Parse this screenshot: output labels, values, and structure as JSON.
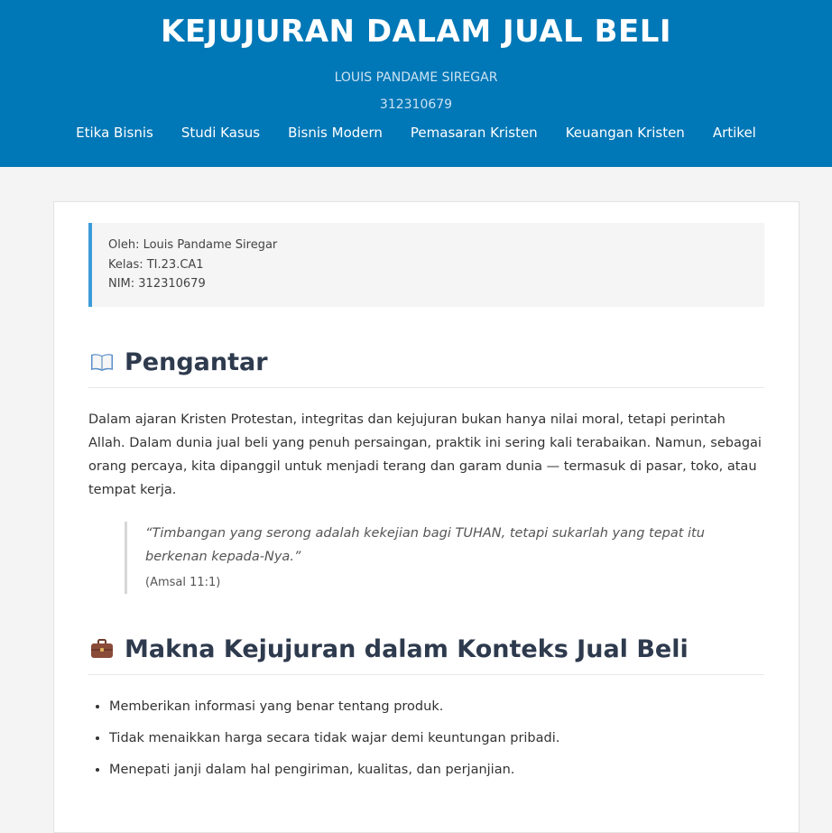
{
  "header": {
    "title": "KEJUJURAN DALAM JUAL BELI",
    "author": "LOUIS PANDAME SIREGAR",
    "nim": "312310679"
  },
  "nav": [
    {
      "label": "Etika Bisnis"
    },
    {
      "label": "Studi Kasus"
    },
    {
      "label": "Bisnis Modern"
    },
    {
      "label": "Pemasaran Kristen"
    },
    {
      "label": "Keuangan Kristen"
    },
    {
      "label": "Artikel"
    }
  ],
  "info": {
    "by": "Oleh: Louis Pandame Siregar",
    "class": "Kelas: TI.23.CA1",
    "nim": "NIM: 312310679"
  },
  "intro": {
    "icon": "open-book-icon",
    "heading": "Pengantar",
    "paragraph": "Dalam ajaran Kristen Protestan, integritas dan kejujuran bukan hanya nilai moral, tetapi perintah Allah. Dalam dunia jual beli yang penuh persaingan, praktik ini sering kali terabaikan. Namun, sebagai orang percaya, kita dipanggil untuk menjadi terang dan garam dunia — termasuk di pasar, toko, atau tempat kerja.",
    "quote": "“Timbangan yang serong adalah kekejian bagi TUHAN, tetapi sukarlah yang tepat itu berkenan kepada-Nya.”",
    "quote_ref": "(Amsal 11:1)"
  },
  "meaning": {
    "icon": "briefcase-icon",
    "heading": "Makna Kejujuran dalam Konteks Jual Beli",
    "items": [
      "Memberikan informasi yang benar tentang produk.",
      "Tidak menaikkan harga secara tidak wajar demi keuntungan pribadi.",
      "Menepati janji dalam hal pengiriman, kualitas, dan perjanjian."
    ]
  }
}
